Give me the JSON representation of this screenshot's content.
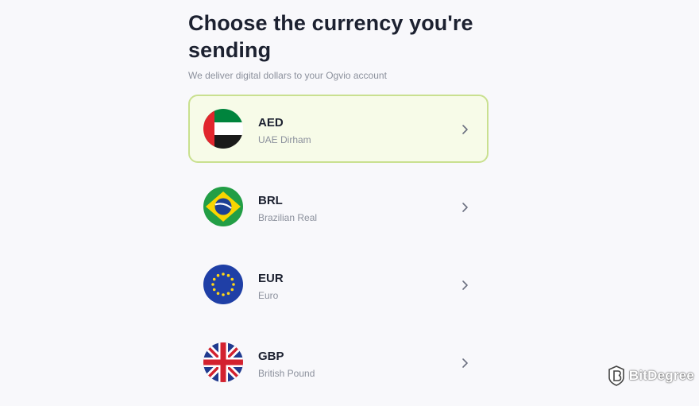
{
  "header": {
    "title": "Choose the currency you're sending",
    "subtitle": "We deliver digital dollars to your Ogvio account"
  },
  "currencies": [
    {
      "code": "AED",
      "name": "UAE Dirham",
      "flag_icon": "uae-flag-icon",
      "selected": true
    },
    {
      "code": "BRL",
      "name": "Brazilian Real",
      "flag_icon": "brazil-flag-icon",
      "selected": false
    },
    {
      "code": "EUR",
      "name": "Euro",
      "flag_icon": "eu-flag-icon",
      "selected": false
    },
    {
      "code": "GBP",
      "name": "British Pound",
      "flag_icon": "uk-flag-icon",
      "selected": false
    }
  ],
  "watermark": {
    "text": "BitDegree"
  },
  "colors": {
    "background": "#f8f8fb",
    "selected_border": "#c9e08f",
    "selected_background": "#f7fbe8",
    "title_text": "#1c2130",
    "muted_text": "#8b909c"
  }
}
